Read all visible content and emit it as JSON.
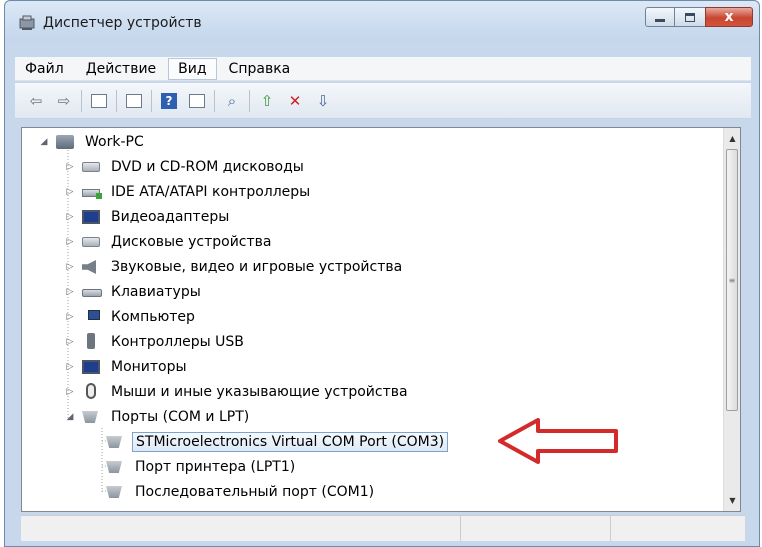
{
  "window": {
    "title": "Диспетчер устройств",
    "close_glyph": "x"
  },
  "menu": [
    "Файл",
    "Действие",
    "Вид",
    "Справка"
  ],
  "menu_open_index": 2,
  "tree": {
    "root": "Work-PC",
    "categories": [
      {
        "label": "DVD и CD-ROM дисководы",
        "icon": "dvd-drive-icon"
      },
      {
        "label": "IDE ATA/ATAPI контроллеры",
        "icon": "ide-controller-icon"
      },
      {
        "label": "Видеоадаптеры",
        "icon": "display-adapter-icon"
      },
      {
        "label": "Дисковые устройства",
        "icon": "disk-drive-icon"
      },
      {
        "label": "Звуковые, видео и игровые устройства",
        "icon": "speaker-icon"
      },
      {
        "label": "Клавиатуры",
        "icon": "keyboard-icon"
      },
      {
        "label": "Компьютер",
        "icon": "computer-icon"
      },
      {
        "label": "Контроллеры USB",
        "icon": "usb-icon"
      },
      {
        "label": "Мониторы",
        "icon": "monitor-icon"
      },
      {
        "label": "Мыши и иные указывающие устройства",
        "icon": "mouse-icon"
      }
    ],
    "ports": {
      "label": "Порты (COM и LPT)",
      "children": [
        {
          "label": "STMicroelectronics Virtual COM Port (COM3)",
          "selected": true
        },
        {
          "label": "Порт принтера (LPT1)",
          "selected": false
        },
        {
          "label": "Последовательный порт (COM1)",
          "selected": false
        }
      ]
    }
  },
  "annotation": {
    "color": "#d42a2a"
  }
}
